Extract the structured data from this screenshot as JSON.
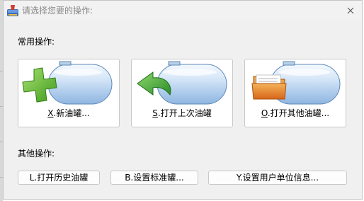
{
  "window": {
    "title": "请选择您要的操作:"
  },
  "common": {
    "heading": "常用操作:",
    "buttons": [
      {
        "mnemonic": "X",
        "label": ".新油罐...",
        "icon": "new-tank-icon"
      },
      {
        "mnemonic": "S",
        "label": ".打开上次油罐",
        "icon": "open-last-tank-icon"
      },
      {
        "mnemonic": "O",
        "label": ".打开其他油罐...",
        "icon": "open-other-tank-icon"
      }
    ]
  },
  "other": {
    "heading": "其他操作:",
    "buttons": [
      {
        "label": "L.打开历史油罐"
      },
      {
        "label": "B.设置标准罐..."
      },
      {
        "label": "Y.设置用户单位信息..."
      }
    ]
  },
  "colors": {
    "tank_body": "#bcd6f0",
    "plus_green": "#5cb82e",
    "arrow_green": "#3aa53a",
    "folder_orange": "#e07a1c"
  }
}
